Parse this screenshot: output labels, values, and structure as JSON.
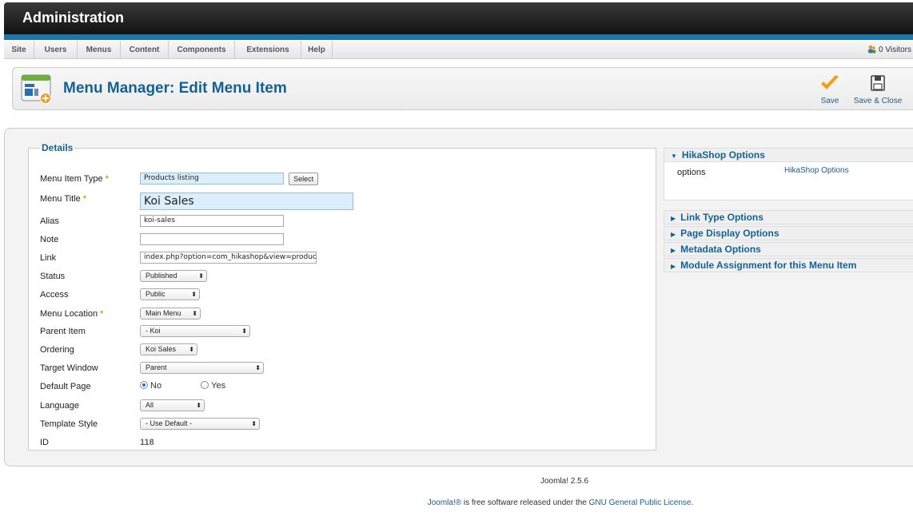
{
  "header": {
    "title": "Administration"
  },
  "menubar": {
    "items": [
      "Site",
      "Users",
      "Menus",
      "Content",
      "Components",
      "Extensions",
      "Help"
    ],
    "visitors": "0 Visitors"
  },
  "toolbar": {
    "page_title": "Menu Manager: Edit Menu Item",
    "save_label": "Save",
    "save_close_label": "Save & Close"
  },
  "details": {
    "legend": "Details",
    "menu_item_type": {
      "label": "Menu Item Type",
      "value": "Products listing",
      "button": "Select",
      "required": "*"
    },
    "menu_title": {
      "label": "Menu Title",
      "value": "Koi Sales",
      "required": "*"
    },
    "alias": {
      "label": "Alias",
      "value": "koi-sales"
    },
    "note": {
      "label": "Note",
      "value": ""
    },
    "link": {
      "label": "Link",
      "value": "index.php?option=com_hikashop&view=product&"
    },
    "status": {
      "label": "Status",
      "value": "Published"
    },
    "access": {
      "label": "Access",
      "value": "Public"
    },
    "menu_location": {
      "label": "Menu Location",
      "value": "Main Menu",
      "required": "*"
    },
    "parent_item": {
      "label": "Parent Item",
      "value": "- Koi"
    },
    "ordering": {
      "label": "Ordering",
      "value": "Koi Sales"
    },
    "target_window": {
      "label": "Target Window",
      "value": "Parent"
    },
    "default_page": {
      "label": "Default Page",
      "no": "No",
      "yes": "Yes",
      "selected": "No"
    },
    "language": {
      "label": "Language",
      "value": "All"
    },
    "template_style": {
      "label": "Template Style",
      "value": "- Use Default -"
    },
    "id": {
      "label": "ID",
      "value": "118"
    }
  },
  "options": {
    "hikashop": {
      "title": "HikaShop Options",
      "row_label": "options",
      "row_value": "HikaShop Options"
    },
    "panels": [
      "Link Type Options",
      "Page Display Options",
      "Metadata Options",
      "Module Assignment for this Menu Item"
    ]
  },
  "footer": {
    "version": "Joomla! 2.5.6",
    "license_pre": "Joomla!®",
    "license_mid": " is free software released under the ",
    "license_link": "GNU General Public License",
    "license_end": "."
  },
  "colors": {
    "accent": "#146295",
    "strip": "#1d75a8",
    "required": "#e0a020",
    "save_check": "#f0a020"
  }
}
